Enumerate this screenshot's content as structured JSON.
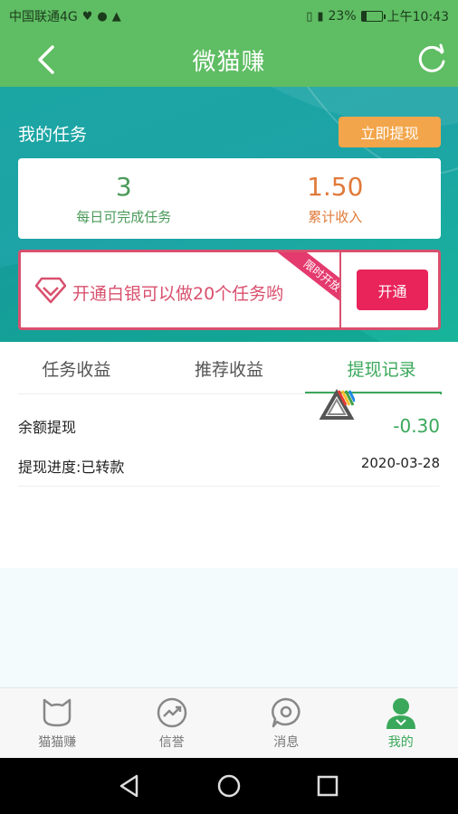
{
  "status_bar": {
    "carrier": "中国联通4G",
    "battery_percent": "23%",
    "battery_level": 0.23,
    "time": "上午10:43"
  },
  "header": {
    "title": "微猫赚"
  },
  "tasks": {
    "title": "我的任务",
    "withdraw_label": "立即提现",
    "daily_tasks_value": "3",
    "daily_tasks_label": "每日可完成任务",
    "income_value": "1.50",
    "income_label": "累计收入"
  },
  "promo": {
    "text": "开通白银可以做20个任务哟",
    "ribbon": "限时开放",
    "button_label": "开通"
  },
  "tabs": [
    "任务收益",
    "推荐收益",
    "提现记录"
  ],
  "active_tab": 2,
  "record": {
    "title": "余额提现",
    "amount": "-0.30",
    "status": "提现进度:已转款",
    "date": "2020-03-28"
  },
  "bottom_nav": [
    "猫猫赚",
    "信誉",
    "消息",
    "我的"
  ],
  "colors": {
    "brand_green": "#5fbd63",
    "accent_green": "#3aa85a",
    "teal": "#1da3a6",
    "orange": "#f2a54a",
    "pink": "#e8245a"
  }
}
